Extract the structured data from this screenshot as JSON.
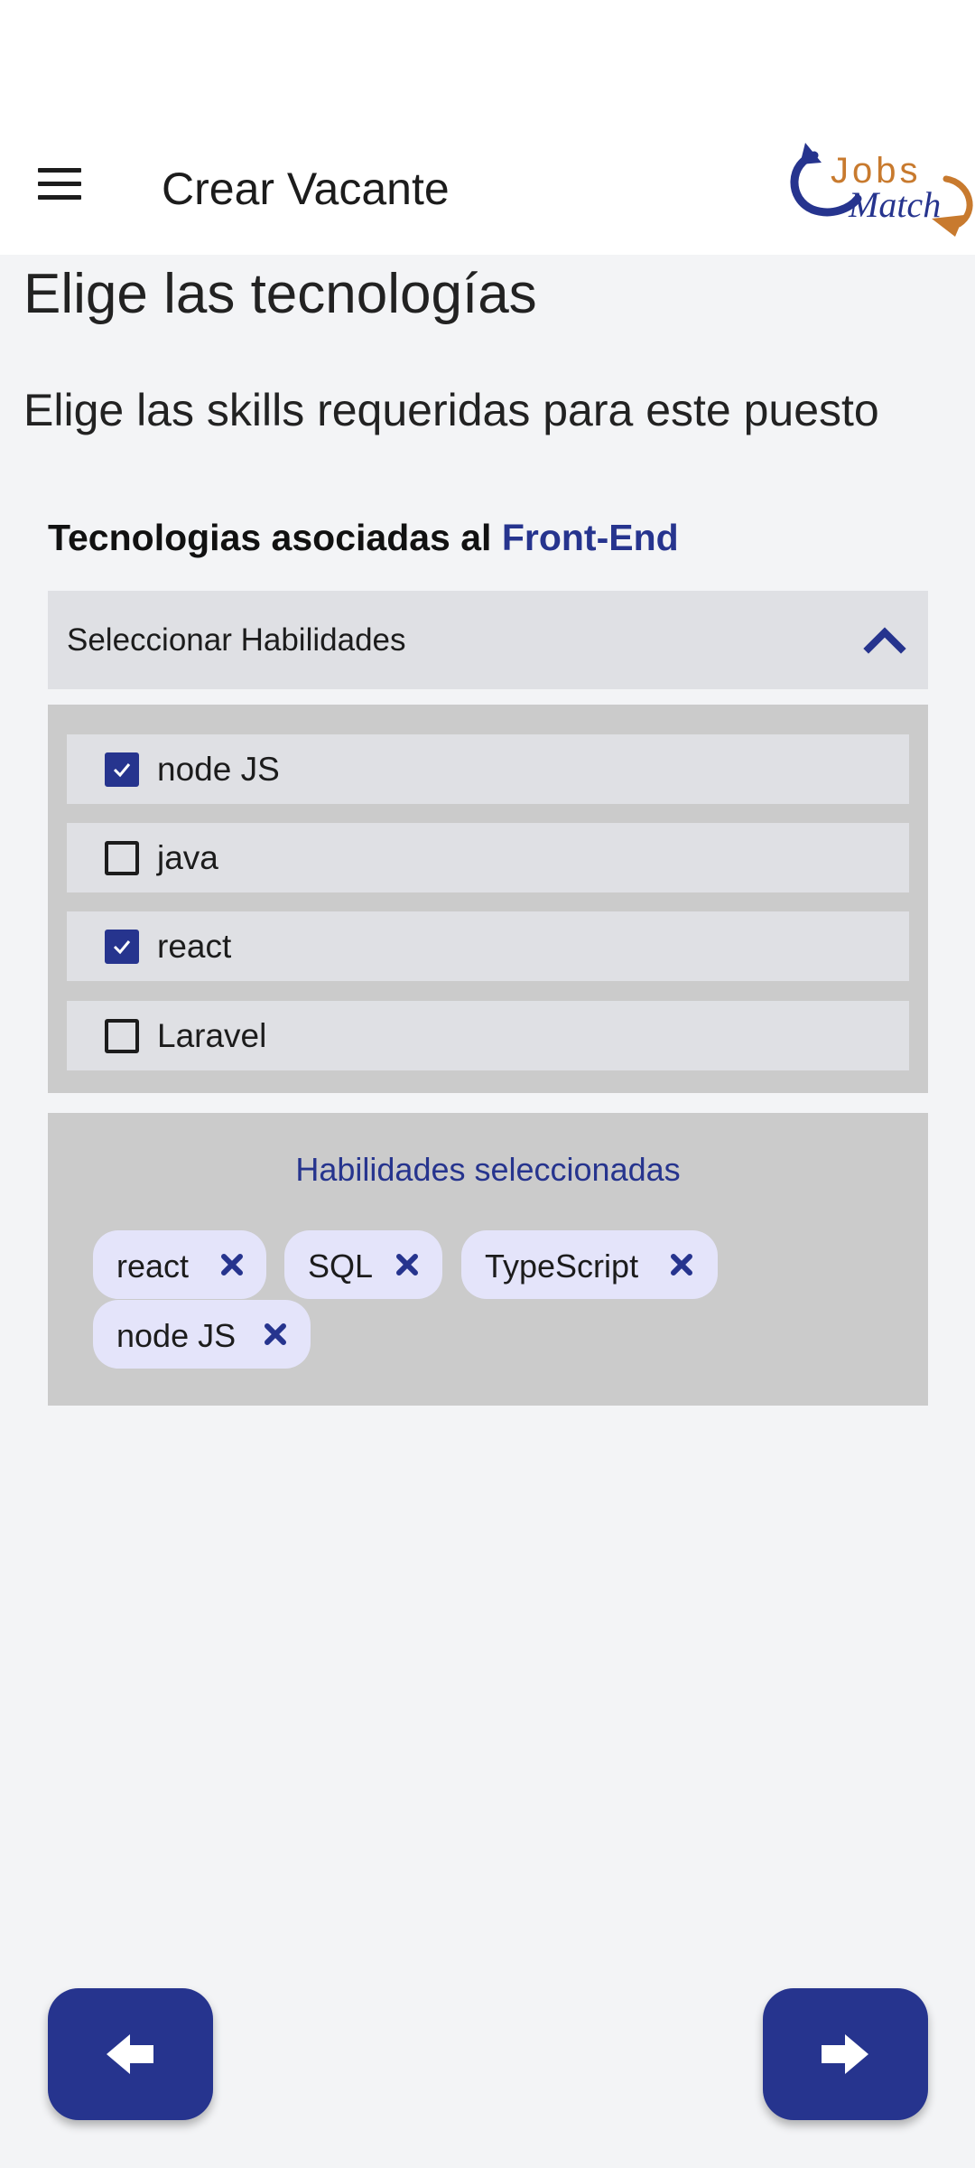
{
  "app": {
    "title": "Crear Vacante",
    "logo_text_top": "Jobs",
    "logo_text_bottom": "Match"
  },
  "page": {
    "heading": "Elige las tecnologías",
    "subheading": "Elige las skills requeridas para este puesto",
    "section_prefix": "Tecnologias asociadas al ",
    "section_accent": "Front-End"
  },
  "dropdown": {
    "label": "Seleccionar Habilidades",
    "expanded": true
  },
  "options": [
    {
      "label": "node JS",
      "checked": true
    },
    {
      "label": "java",
      "checked": false
    },
    {
      "label": "react",
      "checked": true
    },
    {
      "label": "Laravel",
      "checked": false
    }
  ],
  "selected": {
    "title": "Habilidades seleccionadas",
    "chips": [
      {
        "label": "react"
      },
      {
        "label": "SQL"
      },
      {
        "label": "TypeScript"
      },
      {
        "label": "node JS"
      }
    ]
  },
  "colors": {
    "primary": "#26348e",
    "logo_orange": "#c87a2e",
    "chip_bg": "#e4e4fa"
  },
  "icons": {
    "menu": "hamburger-menu-icon",
    "chevron": "chevron-up-icon",
    "check": "check-icon",
    "remove": "close-icon",
    "back": "arrow-left-icon",
    "next": "arrow-right-icon"
  }
}
